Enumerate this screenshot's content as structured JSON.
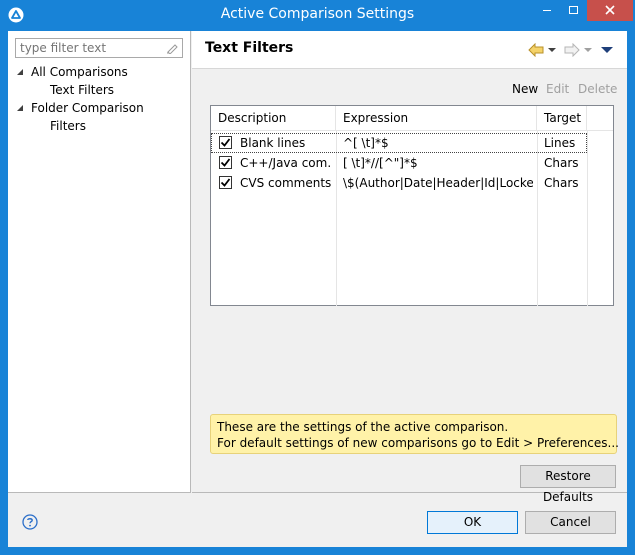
{
  "window": {
    "title": "Active Comparison Settings"
  },
  "filter": {
    "placeholder": "type filter text"
  },
  "tree": {
    "items": [
      {
        "label": "All Comparisons"
      },
      {
        "label": "Text Filters"
      },
      {
        "label": "Folder Comparison"
      },
      {
        "label": "Filters"
      }
    ]
  },
  "page": {
    "title": "Text Filters"
  },
  "actions": {
    "new": "New",
    "edit": "Edit",
    "delete": "Delete"
  },
  "table": {
    "columns": [
      "Description",
      "Expression",
      "Target"
    ],
    "rows": [
      {
        "checked": true,
        "description": "Blank lines",
        "expression": "^[ \\t]*$",
        "target": "Lines"
      },
      {
        "checked": true,
        "description": "C++/Java com...",
        "expression": "[ \\t]*//[^\"]*$",
        "target": "Chars"
      },
      {
        "checked": true,
        "description": "CVS comments",
        "expression": "\\$(Author|Date|Header|Id|Locker|...",
        "target": "Chars"
      }
    ]
  },
  "info": {
    "line1": "These are the settings of the active comparison.",
    "line2": "For default settings of new comparisons go to Edit > Preferences..."
  },
  "buttons": {
    "restore": "Restore Defaults",
    "ok": "OK",
    "cancel": "Cancel"
  },
  "colors": {
    "titlebar": "#1883d7",
    "close": "#c7504b",
    "info_bg": "#fff2a8"
  }
}
